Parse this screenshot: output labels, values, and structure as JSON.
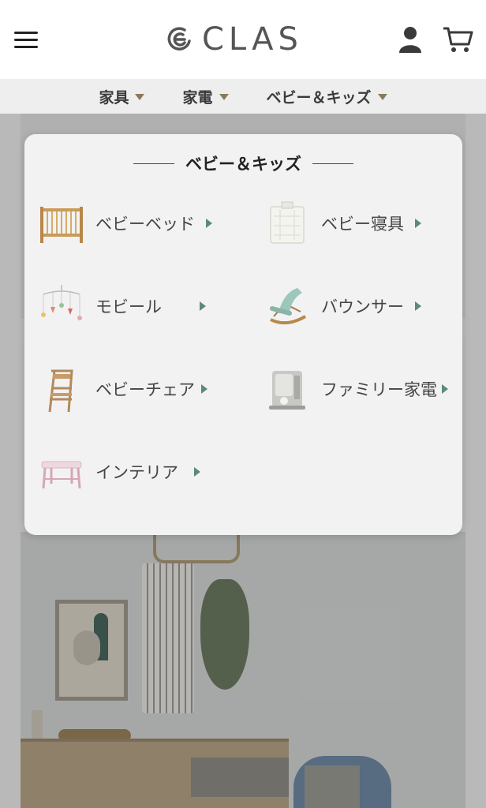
{
  "header": {
    "logo_text": "CLAS"
  },
  "category_bar": {
    "items": [
      {
        "label": "家具"
      },
      {
        "label": "家電"
      },
      {
        "label": "ベビー＆キッズ"
      }
    ]
  },
  "dropdown": {
    "title": "ベビー＆キッズ",
    "items": [
      {
        "label": "ベビーベッド",
        "icon": "baby-crib-icon"
      },
      {
        "label": "ベビー寝具",
        "icon": "baby-bedding-icon"
      },
      {
        "label": "モビール",
        "icon": "mobile-icon"
      },
      {
        "label": "バウンサー",
        "icon": "bouncer-icon"
      },
      {
        "label": "ベビーチェア",
        "icon": "baby-chair-icon"
      },
      {
        "label": "ファミリー家電",
        "icon": "family-appliance-icon"
      },
      {
        "label": "インテリア",
        "icon": "interior-icon"
      }
    ]
  },
  "colors": {
    "arrow": "#5b8a76",
    "category_triangle": "#8a7a5c"
  }
}
